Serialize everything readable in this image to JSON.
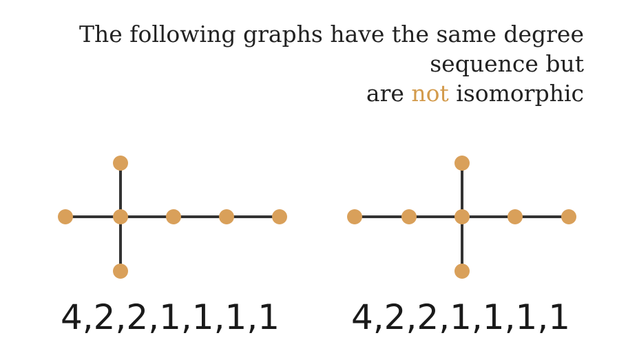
{
  "heading": {
    "line1": "The following graphs have the same degree",
    "line2": "sequence but",
    "line3_pre": "are",
    "line3_highlight": "not",
    "line3_post": "isomorphic"
  },
  "colors": {
    "node": "#d9a05a",
    "edge": "#333333",
    "highlight": "#d39b4c",
    "text": "#222222"
  },
  "graphs": [
    {
      "degree_sequence": "4,2,2,1,1,1,1"
    },
    {
      "degree_sequence": "4,2,2,1,1,1,1"
    }
  ]
}
